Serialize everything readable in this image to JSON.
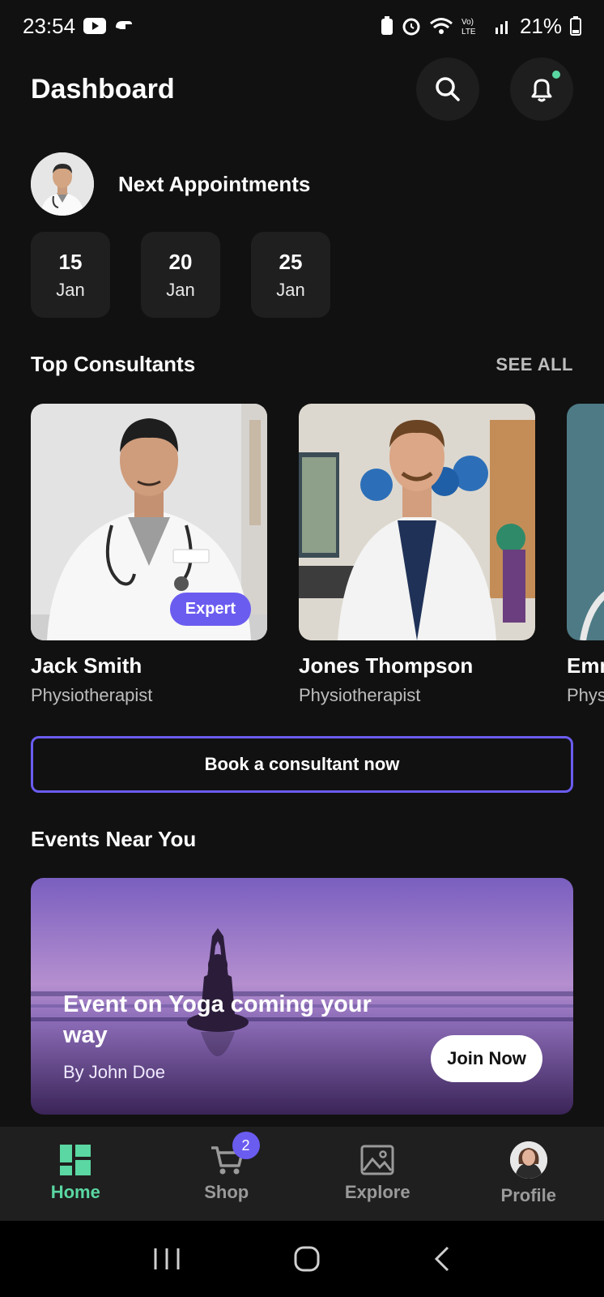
{
  "status_bar": {
    "time": "23:54",
    "battery": "21%"
  },
  "header": {
    "title": "Dashboard"
  },
  "appointments": {
    "title": "Next Appointments",
    "dates": [
      {
        "day": "15",
        "month": "Jan"
      },
      {
        "day": "20",
        "month": "Jan"
      },
      {
        "day": "25",
        "month": "Jan"
      }
    ]
  },
  "consultants": {
    "title": "Top Consultants",
    "see_all": "SEE ALL",
    "items": [
      {
        "name": "Jack Smith",
        "role": "Physiotherapist",
        "badge": "Expert"
      },
      {
        "name": "Jones Thompson",
        "role": "Physiotherapist"
      },
      {
        "name": "Emm",
        "role": "Phys"
      }
    ]
  },
  "book_button": "Book a consultant now",
  "events": {
    "title": "Events Near You",
    "card": {
      "title": "Event on Yoga coming your way",
      "author": "By John Doe",
      "join_label": "Join Now"
    }
  },
  "bottom_nav": {
    "items": [
      {
        "label": "Home",
        "icon": "home-grid-icon",
        "active": true
      },
      {
        "label": "Shop",
        "icon": "cart-icon",
        "badge": "2"
      },
      {
        "label": "Explore",
        "icon": "image-icon"
      },
      {
        "label": "Profile",
        "icon": "avatar"
      }
    ]
  },
  "colors": {
    "accent_green": "#5ad7a2",
    "accent_purple": "#6b5cf0",
    "background": "#111111",
    "card": "#1f1f1f"
  }
}
